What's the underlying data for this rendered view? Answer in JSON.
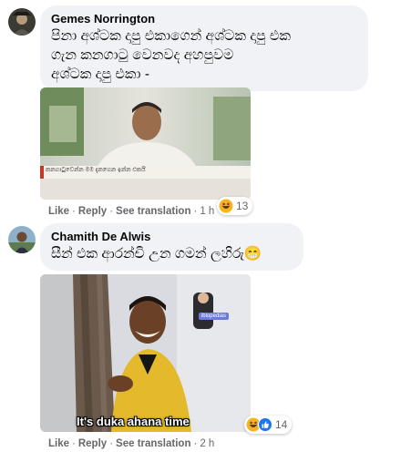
{
  "comments": [
    {
      "author": "Gemes Norrington",
      "text": "පිනා අශ්ටක දාපු එකාගෙන් අශ්ටක දාපු එක\nගැන කනගාටු වෙනවද අහපුවම\nඅශ්ටක දාපු එකා -",
      "image": {
        "caption": "කනගාටුවෙන්න මම දැනගෙන ඉන්න එකයි"
      },
      "actions": {
        "like": "Like",
        "reply": "Reply",
        "translation": "See translation",
        "time": "1 h"
      },
      "reactions": {
        "icons": [
          "haha-icon"
        ],
        "count": "13"
      }
    },
    {
      "author": "Chamith De Alwis",
      "text": "සීන් එක ආරන්චි උන ගමන් ලහිරු😁",
      "image": {
        "caption": "It's duka ahana time",
        "watermark": "iblopedias"
      },
      "actions": {
        "like": "Like",
        "reply": "Reply",
        "translation": "See translation",
        "time": "2 h"
      },
      "reactions": {
        "icons": [
          "haha-icon",
          "like-icon"
        ],
        "count": "14"
      }
    }
  ],
  "colors": {
    "bubble": "#f0f2f5",
    "meta": "#65676b",
    "like": "#1877f2",
    "haha": "#f7b125"
  }
}
